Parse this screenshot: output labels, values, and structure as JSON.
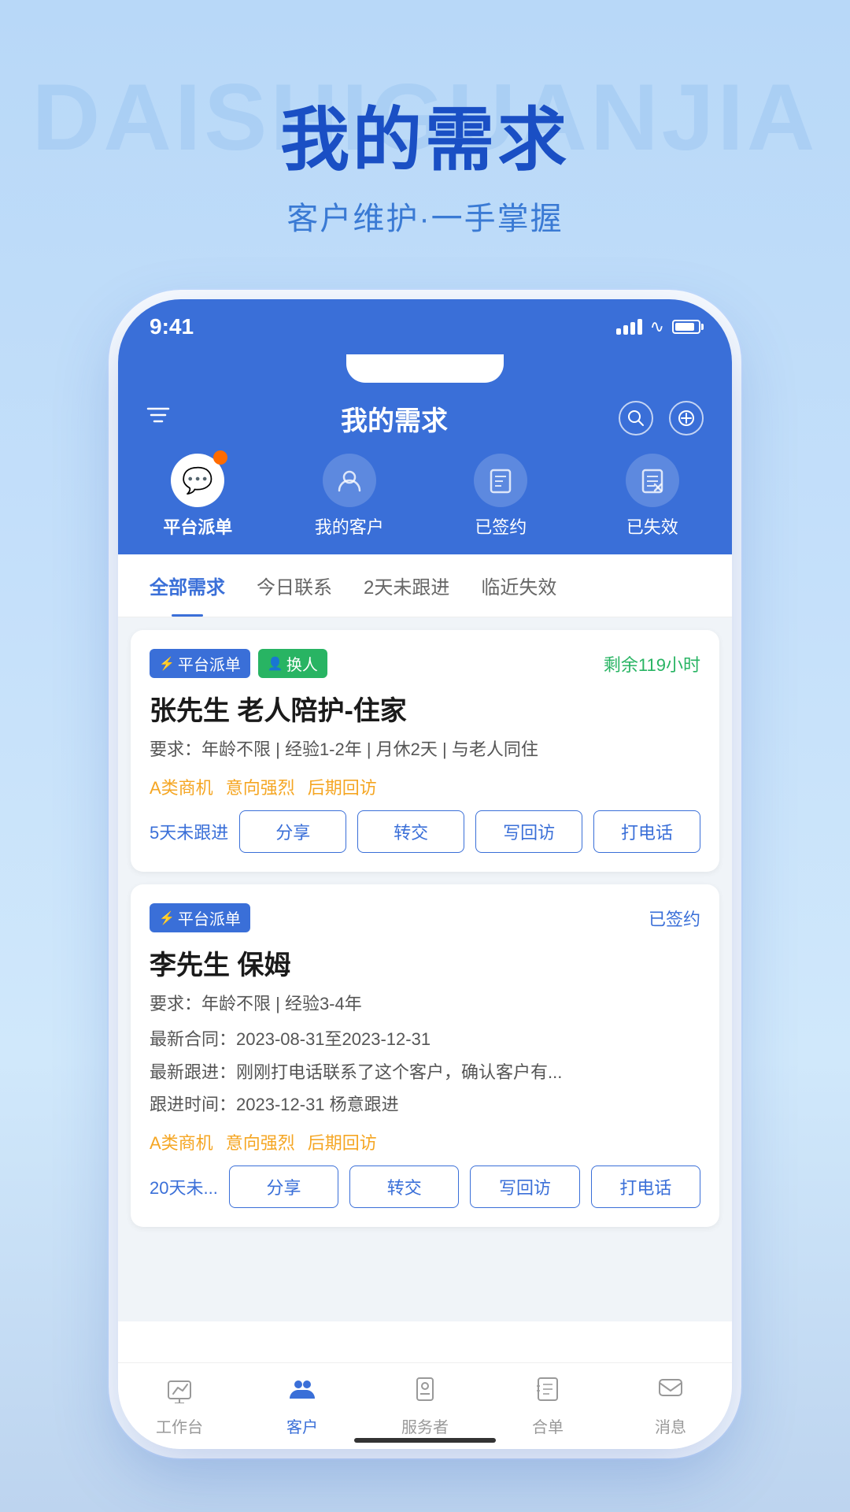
{
  "watermark": "DAISHIGUANJIA",
  "header": {
    "title": "我的需求",
    "subtitle": "客户维护·一手掌握"
  },
  "phone": {
    "status_bar": {
      "time": "9:41",
      "signal_bars": [
        8,
        12,
        16,
        20
      ],
      "wifi": "WiFi",
      "battery": "Battery"
    },
    "nav": {
      "title": "我的需求",
      "filter_icon": "▽",
      "search_icon": "○",
      "add_icon": "⊕"
    },
    "category_tabs": [
      {
        "id": "platform",
        "label": "平台派单",
        "active": true
      },
      {
        "id": "my_client",
        "label": "我的客户",
        "active": false
      },
      {
        "id": "signed",
        "label": "已签约",
        "active": false
      },
      {
        "id": "expired",
        "label": "已失效",
        "active": false
      }
    ],
    "filter_tabs": [
      {
        "id": "all",
        "label": "全部需求",
        "active": true
      },
      {
        "id": "today",
        "label": "今日联系",
        "active": false
      },
      {
        "id": "no_follow",
        "label": "2天未跟进",
        "active": false
      },
      {
        "id": "near_expire",
        "label": "临近失效",
        "active": false
      }
    ],
    "cards": [
      {
        "id": "card1",
        "badge_platform": "平台派单",
        "badge_change": "换人",
        "badge_remaining": "剩余119小时",
        "name": "张先生 老人陪护-住家",
        "requirement": "要求：年龄不限 | 经验1-2年 | 月休2天 | 与老人同住",
        "opportunity_tags": [
          "A类商机",
          "意向强烈",
          "后期回访"
        ],
        "no_follow_days": "5天未跟进",
        "actions": [
          "分享",
          "转交",
          "写回访",
          "打电话"
        ]
      },
      {
        "id": "card2",
        "badge_platform": "平台派单",
        "badge_signed": "已签约",
        "name": "李先生 保姆",
        "requirement": "要求：年龄不限 | 经验3-4年",
        "latest_contract": "最新合同：2023-08-31至2023-12-31",
        "latest_follow": "最新跟进：刚刚打电话联系了这个客户，确认客户有...",
        "follow_time": "跟进时间：2023-12-31 杨意跟进",
        "opportunity_tags": [
          "A类商机",
          "意向强烈",
          "后期回访"
        ],
        "no_follow_days": "20天未...",
        "actions": [
          "分享",
          "转交",
          "写回访",
          "打电话"
        ]
      }
    ],
    "bottom_nav": [
      {
        "id": "workbench",
        "label": "工作台",
        "active": false,
        "icon": "📊"
      },
      {
        "id": "client",
        "label": "客户",
        "active": true,
        "icon": "👥"
      },
      {
        "id": "service",
        "label": "服务者",
        "active": false,
        "icon": "🏷"
      },
      {
        "id": "contract",
        "label": "合单",
        "active": false,
        "icon": "📋"
      },
      {
        "id": "message",
        "label": "消息",
        "active": false,
        "icon": "💬"
      }
    ]
  },
  "colors": {
    "primary": "#3a6fd8",
    "green": "#28b463",
    "orange": "#f5a623",
    "light_bg": "#f0f4f8"
  }
}
